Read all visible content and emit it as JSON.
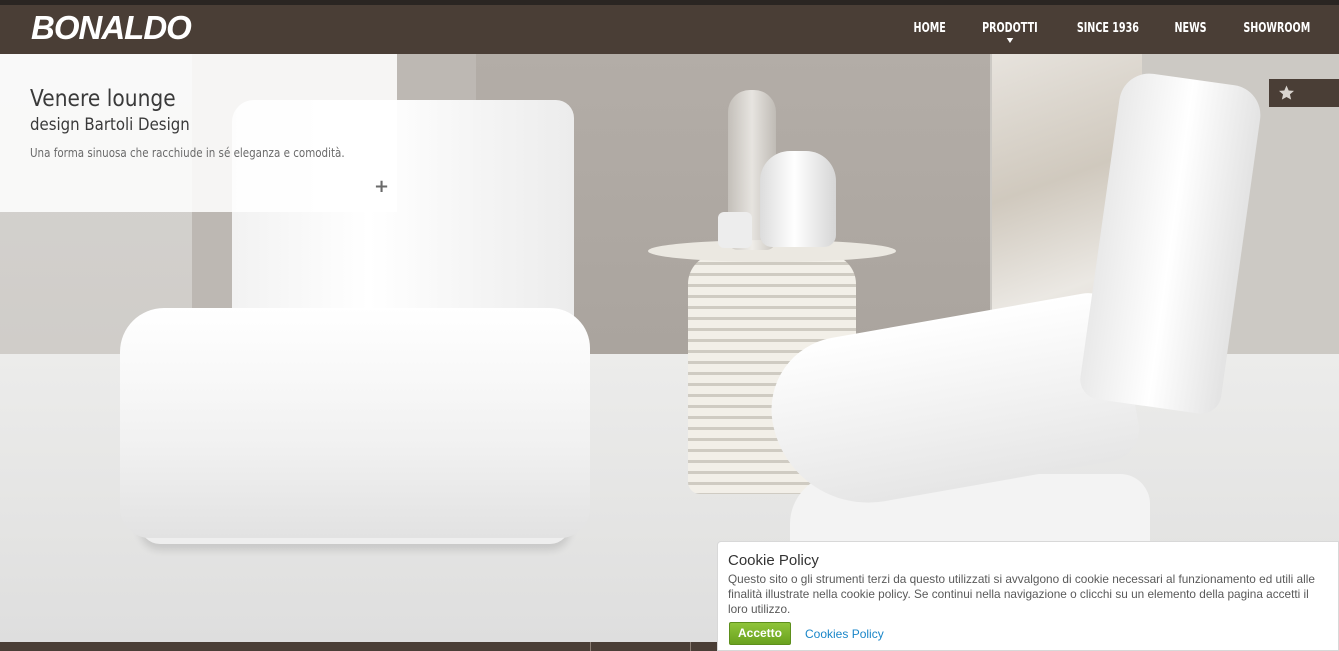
{
  "header": {
    "logo": "BONALDO",
    "nav": [
      {
        "label": "HOME",
        "has_dropdown": false
      },
      {
        "label": "PRODOTTI",
        "has_dropdown": true
      },
      {
        "label": "SINCE 1936",
        "has_dropdown": false
      },
      {
        "label": "NEWS",
        "has_dropdown": false
      },
      {
        "label": "SHOWROOM",
        "has_dropdown": false
      }
    ]
  },
  "hero": {
    "title": "Venere lounge",
    "subtitle": "design Bartoli Design",
    "description": "Una forma sinuosa che racchiude in sé eleganza e comodità.",
    "more_icon": "plus-icon",
    "favorite_icon": "star-icon"
  },
  "cookie": {
    "title": "Cookie Policy",
    "text": "Questo sito o gli strumenti terzi da questo utilizzati si avvalgono di cookie necessari al funzionamento ed utili alle finalità illustrate nella cookie policy. Se continui nella navigazione o clicchi su un elemento della pagina accetti il loro utilizzo.",
    "accept_label": "Accetto",
    "link_label": "Cookies Policy"
  },
  "colors": {
    "header_bg": "#4a3e36",
    "accept_button": "#7ab32b",
    "link": "#1a86c8"
  }
}
